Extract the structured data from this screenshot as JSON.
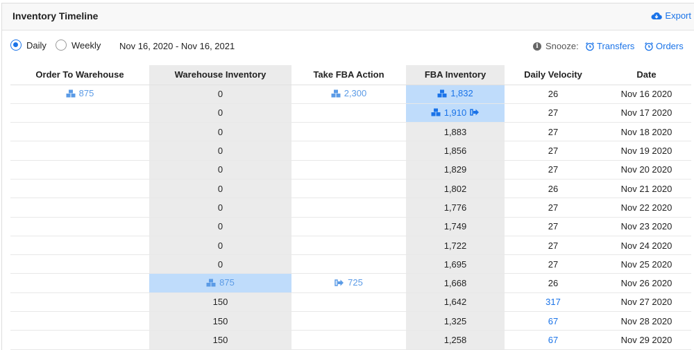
{
  "header": {
    "title": "Inventory Timeline",
    "export_label": "Export"
  },
  "controls": {
    "daily_label": "Daily",
    "weekly_label": "Weekly",
    "selected": "daily",
    "date_range": "Nov 16, 2020 - Nov 16, 2021",
    "snooze_label": "Snooze:",
    "transfers_label": "Transfers",
    "orders_label": "Orders"
  },
  "colors": {
    "accent": "#1a73e8",
    "highlight": "#bfdcfb",
    "shaded_column": "#ebebeb"
  },
  "table": {
    "columns": [
      "Order To Warehouse",
      "Warehouse Inventory",
      "Take FBA Action",
      "FBA Inventory",
      "Daily Velocity",
      "Date"
    ],
    "rows": [
      {
        "order": "875",
        "warehouse": "0",
        "action": "2,300",
        "fba": "1,832",
        "velocity": "26",
        "date": "Nov 16 2020"
      },
      {
        "order": "",
        "warehouse": "0",
        "action": "",
        "fba": "1,910",
        "velocity": "27",
        "date": "Nov 17 2020"
      },
      {
        "order": "",
        "warehouse": "0",
        "action": "",
        "fba": "1,883",
        "velocity": "27",
        "date": "Nov 18 2020"
      },
      {
        "order": "",
        "warehouse": "0",
        "action": "",
        "fba": "1,856",
        "velocity": "27",
        "date": "Nov 19 2020"
      },
      {
        "order": "",
        "warehouse": "0",
        "action": "",
        "fba": "1,829",
        "velocity": "27",
        "date": "Nov 20 2020"
      },
      {
        "order": "",
        "warehouse": "0",
        "action": "",
        "fba": "1,802",
        "velocity": "26",
        "date": "Nov 21 2020"
      },
      {
        "order": "",
        "warehouse": "0",
        "action": "",
        "fba": "1,776",
        "velocity": "27",
        "date": "Nov 22 2020"
      },
      {
        "order": "",
        "warehouse": "0",
        "action": "",
        "fba": "1,749",
        "velocity": "27",
        "date": "Nov 23 2020"
      },
      {
        "order": "",
        "warehouse": "0",
        "action": "",
        "fba": "1,722",
        "velocity": "27",
        "date": "Nov 24 2020"
      },
      {
        "order": "",
        "warehouse": "0",
        "action": "",
        "fba": "1,695",
        "velocity": "27",
        "date": "Nov 25 2020"
      },
      {
        "order": "",
        "warehouse": "875",
        "action": "725",
        "fba": "1,668",
        "velocity": "26",
        "date": "Nov 26 2020"
      },
      {
        "order": "",
        "warehouse": "150",
        "action": "",
        "fba": "1,642",
        "velocity": "317",
        "date": "Nov 27 2020"
      },
      {
        "order": "",
        "warehouse": "150",
        "action": "",
        "fba": "1,325",
        "velocity": "67",
        "date": "Nov 28 2020"
      },
      {
        "order": "",
        "warehouse": "150",
        "action": "",
        "fba": "1,258",
        "velocity": "67",
        "date": "Nov 29 2020"
      }
    ]
  }
}
